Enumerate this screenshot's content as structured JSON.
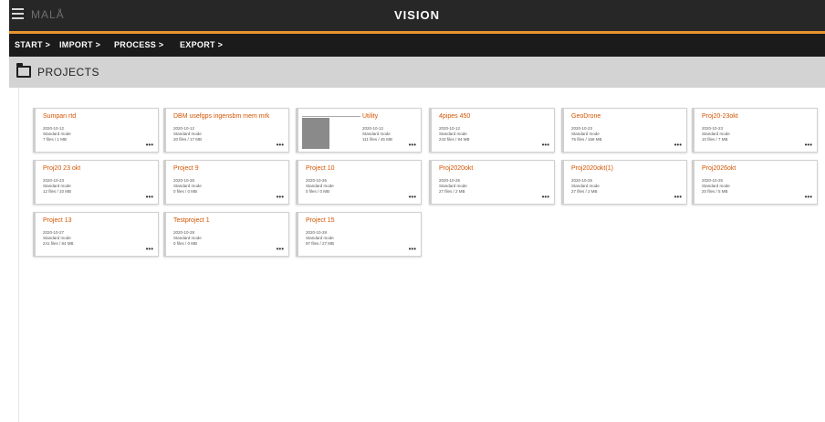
{
  "app": {
    "logo": "MALÅ",
    "title": "VISION"
  },
  "breadcrumb": [
    "START >",
    "IMPORT >",
    "PROCESS >",
    "EXPORT >"
  ],
  "page": {
    "title": "PROJECTS"
  },
  "projects": [
    {
      "name": "Sumpan rtd",
      "date": "2020-10-12",
      "mode": "Standard mode",
      "files": "7 files / 1 MB"
    },
    {
      "name": "DBM usefgps ingensbm mem mrk",
      "date": "2020-10-12",
      "mode": "Standard mode",
      "files": "20 files / 17 MB"
    },
    {
      "name": "Utility",
      "date": "2020-10-12",
      "mode": "Standard mode",
      "files": "111 files / 45 MB"
    },
    {
      "name": "4pipes 450",
      "date": "2020-10-12",
      "mode": "Standard mode",
      "files": "243 files / 84 MB"
    },
    {
      "name": "GeoDrone",
      "date": "2020-10-23",
      "mode": "Standard mode",
      "files": "75 files / 158 MB"
    },
    {
      "name": "Proj20-23okt",
      "date": "2020-10-23",
      "mode": "Standard mode",
      "files": "10 files / 7 MB"
    },
    {
      "name": "Proj20 23 okt",
      "date": "2020-10-23",
      "mode": "Standard mode",
      "files": "12 files / 10 MB"
    },
    {
      "name": "Project 9",
      "date": "2020-10-26",
      "mode": "Standard mode",
      "files": "0 files / 0 MB"
    },
    {
      "name": "Project 10",
      "date": "2020-10-26",
      "mode": "Standard mode",
      "files": "0 files / 0 MB"
    },
    {
      "name": "Proj2020okt",
      "date": "2020-10-26",
      "mode": "Standard mode",
      "files": "27 files / 2 MB"
    },
    {
      "name": "Proj2020okt(1)",
      "date": "2020-10-26",
      "mode": "Standard mode",
      "files": "27 files / 2 MB"
    },
    {
      "name": "Proj2026okt",
      "date": "2020-10-26",
      "mode": "Standard mode",
      "files": "20 files / 5 MB"
    },
    {
      "name": "Project 13",
      "date": "2020-10-27",
      "mode": "Standard mode",
      "files": "241 files / 84 MB"
    },
    {
      "name": "Testproject 1",
      "date": "2020-10-28",
      "mode": "Standard mode",
      "files": "0 files / 0 MB"
    },
    {
      "name": "Project 15",
      "date": "2020-10-28",
      "mode": "Standard mode",
      "files": "97 files / 27 MB"
    }
  ],
  "card_menu_label": "•••",
  "colors": {
    "accent": "#e8942e",
    "title": "#d35400",
    "topbar": "#272727"
  }
}
